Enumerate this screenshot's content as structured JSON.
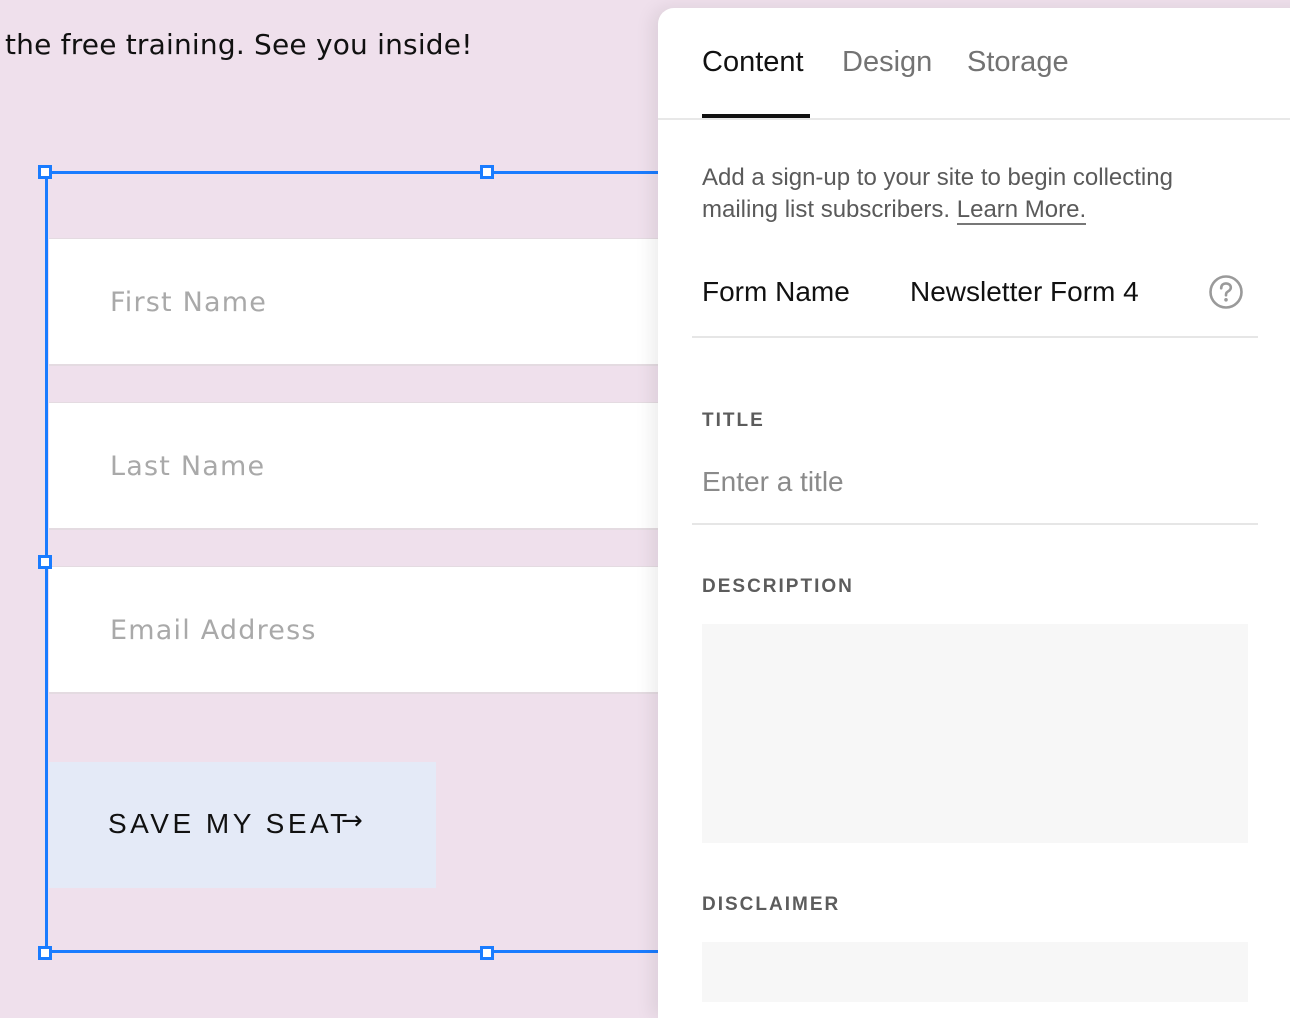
{
  "canvas": {
    "intro_text": "the free training. See you inside!",
    "fields": [
      {
        "placeholder": "First Name"
      },
      {
        "placeholder": "Last Name"
      },
      {
        "placeholder": "Email Address"
      }
    ],
    "button": {
      "label": "SAVE MY SEAT",
      "arrow": "→"
    }
  },
  "panel": {
    "tabs": [
      {
        "label": "Content",
        "active": true
      },
      {
        "label": "Design",
        "active": false
      },
      {
        "label": "Storage",
        "active": false
      }
    ],
    "intro": "Add a sign-up to your site to begin collecting mailing list subscribers. ",
    "learn_more": "Learn More.",
    "form_name_label": "Form Name",
    "form_name_value": "Newsletter Form 4",
    "title_label": "TITLE",
    "title_placeholder": "Enter a title",
    "description_label": "DESCRIPTION",
    "disclaimer_label": "DISCLAIMER"
  },
  "colors": {
    "selection": "#1a7cff",
    "canvas_bg": "#efe0ec",
    "button_bg": "#e4eaf7"
  }
}
